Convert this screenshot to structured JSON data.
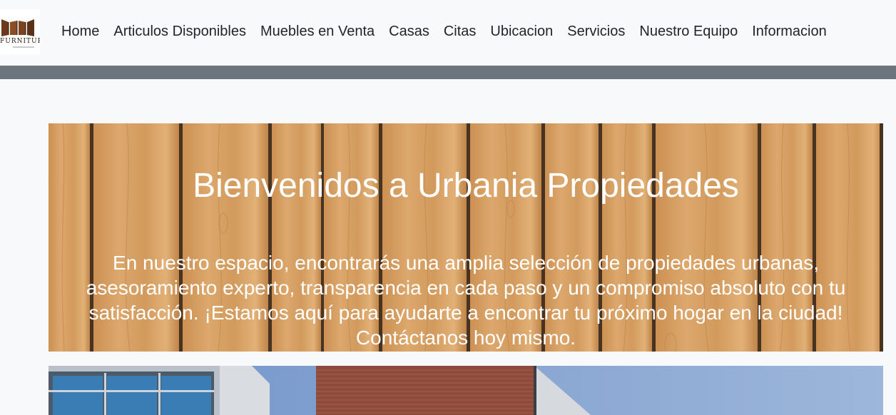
{
  "brand": {
    "logo_text": "FURNITURE"
  },
  "nav": {
    "items": [
      {
        "label": "Home",
        "name": "nav-home"
      },
      {
        "label": "Articulos Disponibles",
        "name": "nav-articulos-disponibles"
      },
      {
        "label": "Muebles en Venta",
        "name": "nav-muebles-en-venta"
      },
      {
        "label": "Casas",
        "name": "nav-casas"
      },
      {
        "label": "Citas",
        "name": "nav-citas"
      },
      {
        "label": "Ubicacion",
        "name": "nav-ubicacion"
      },
      {
        "label": "Servicios",
        "name": "nav-servicios"
      },
      {
        "label": "Nuestro Equipo",
        "name": "nav-nuestro-equipo"
      },
      {
        "label": "Informacion",
        "name": "nav-informacion"
      }
    ]
  },
  "hero": {
    "title": "Bienvenidos a Urbania Propiedades",
    "text": "En nuestro espacio, encontrarás una amplia selección de propiedades urbanas, asesoramiento experto, transparencia en cada paso y un compromiso absoluto con tu satisfacción. ¡Estamos aquí para ayudarte a encontrar tu próximo hogar en la ciudad! Contáctanos hoy mismo."
  },
  "colors": {
    "navbar_bg": "#f8f9fa",
    "divider_bar": "#6c757d",
    "hero_text": "#ffffff"
  }
}
